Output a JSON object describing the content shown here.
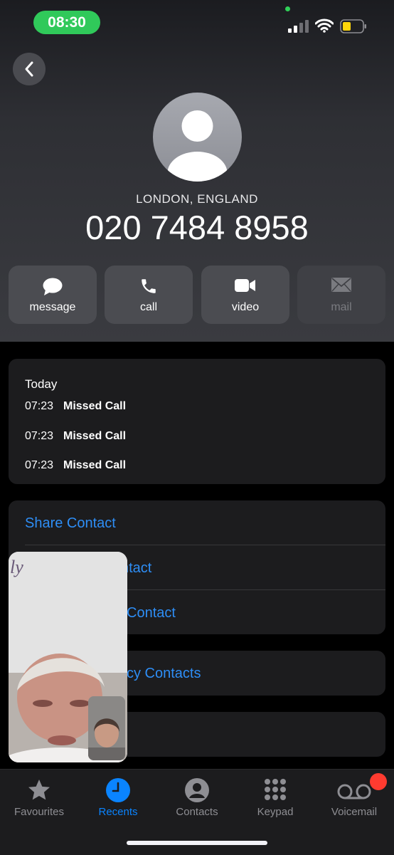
{
  "status": {
    "time": "08:30"
  },
  "contact": {
    "location": "LONDON, ENGLAND",
    "number": "020 7484 8958"
  },
  "actions": [
    {
      "label": "message"
    },
    {
      "label": "call"
    },
    {
      "label": "video"
    },
    {
      "label": "mail"
    }
  ],
  "recents": {
    "heading": "Today",
    "items": [
      {
        "time": "07:23",
        "status": "Missed Call"
      },
      {
        "time": "07:23",
        "status": "Missed Call"
      },
      {
        "time": "07:23",
        "status": "Missed Call"
      }
    ]
  },
  "options": {
    "share": "Share Contact",
    "item2": "ntact",
    "item3": "Contact",
    "item4": "cy Contacts"
  },
  "tabs": [
    {
      "label": "Favourites"
    },
    {
      "label": "Recents"
    },
    {
      "label": "Contacts"
    },
    {
      "label": "Keypad"
    },
    {
      "label": "Voicemail"
    }
  ],
  "colors": {
    "accent": "#0a84ff",
    "link": "#2e8ef6",
    "status_pill": "#30c95a",
    "badge": "#ff3b30"
  },
  "pip": {
    "overlay_text": "ly"
  }
}
